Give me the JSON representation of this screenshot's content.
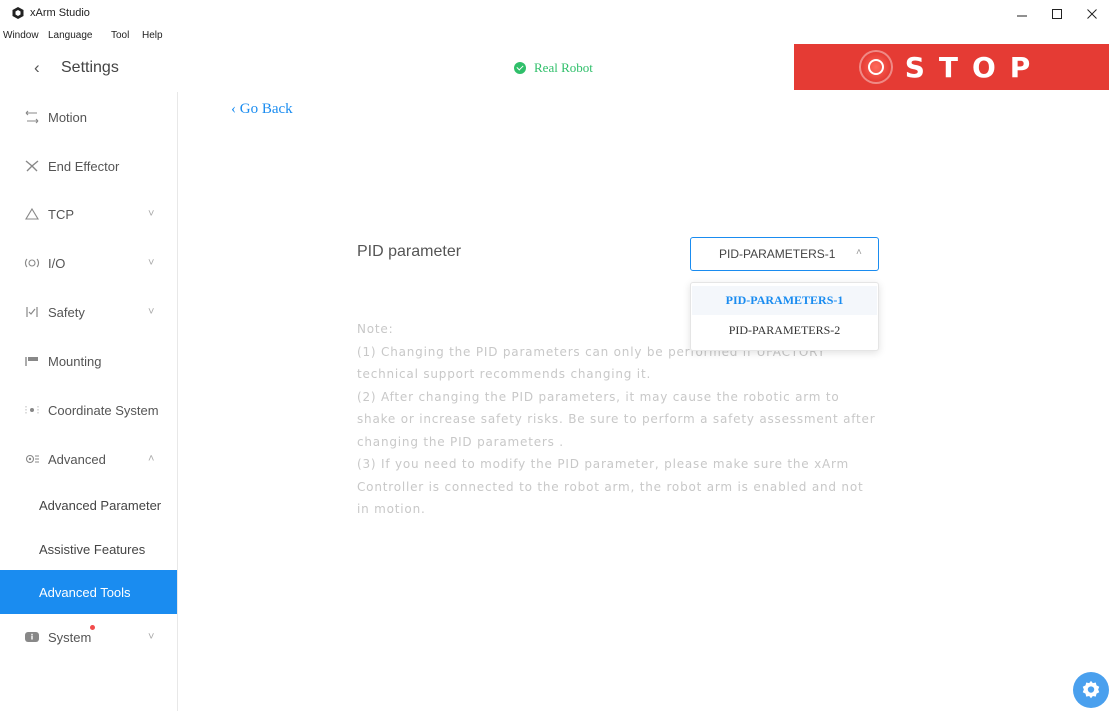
{
  "window": {
    "title": "xArm Studio"
  },
  "menu": [
    "Window",
    "Language",
    "Tool",
    "Help"
  ],
  "header": {
    "settings_title": "Settings",
    "robot_status": "Real Robot",
    "stop_label": "STOP"
  },
  "sidebar": {
    "items": [
      {
        "label": "Motion",
        "icon": "motion-icon"
      },
      {
        "label": "End Effector",
        "icon": "end-effector-icon"
      },
      {
        "label": "TCP",
        "icon": "tcp-icon"
      },
      {
        "label": "I/O",
        "icon": "io-icon"
      },
      {
        "label": "Safety",
        "icon": "safety-icon"
      },
      {
        "label": "Mounting",
        "icon": "mounting-icon"
      },
      {
        "label": "Coordinate System",
        "icon": "coordinate-icon"
      },
      {
        "label": "Advanced",
        "icon": "advanced-icon"
      }
    ],
    "sub_items": [
      {
        "label": "Advanced Parameter"
      },
      {
        "label": "Assistive Features"
      },
      {
        "label": "Advanced Tools"
      }
    ],
    "system": {
      "label": "System",
      "icon": "system-icon"
    }
  },
  "main": {
    "go_back": "Go Back",
    "pid_label": "PID parameter",
    "pid_value": "PID-PARAMETERS-1",
    "options": [
      "PID-PARAMETERS-1",
      "PID-PARAMETERS-2"
    ],
    "note": {
      "title": "Note:",
      "line1": "(1) Changing the PID parameters can only be performed if UFACTORY technical support recommends changing it.",
      "line2": "(2) After changing the PID parameters, it may cause the robotic arm to shake or increase safety risks. Be sure to perform a safety assessment after changing the PID parameters .",
      "line3": "(3) If you need to modify the PID parameter, please make sure the xArm Controller is connected to the robot arm, the robot arm is enabled and not in motion."
    }
  },
  "colors": {
    "accent": "#1a8cf0",
    "stop": "#e53b34",
    "status_green": "#2fbf6a"
  }
}
